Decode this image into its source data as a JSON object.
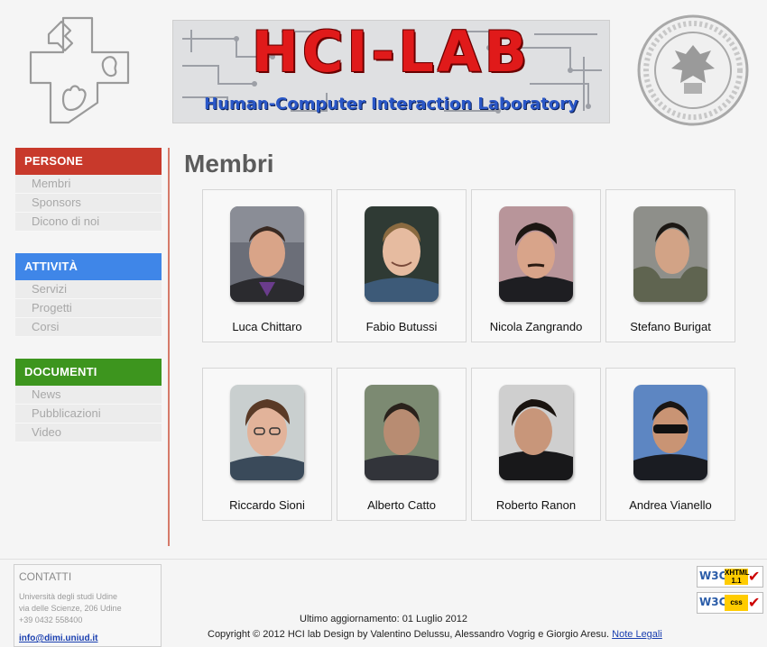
{
  "header": {
    "banner_title": "HCI-LAB",
    "banner_subtitle": "Human-Computer Interaction Laboratory"
  },
  "sidebar": {
    "sections": [
      {
        "label": "PERSONE",
        "color": "#c8392b",
        "items": [
          "Membri",
          "Sponsors",
          "Dicono di noi"
        ]
      },
      {
        "label": "ATTIVITÀ",
        "color": "#3f86e8",
        "items": [
          "Servizi",
          "Progetti",
          "Corsi"
        ]
      },
      {
        "label": "DOCUMENTI",
        "color": "#3d951e",
        "items": [
          "News",
          "Pubblicazioni",
          "Video"
        ]
      }
    ]
  },
  "main": {
    "title": "Membri",
    "members": [
      {
        "name": "Luca Chittaro",
        "icon": "portrait-photo"
      },
      {
        "name": "Fabio Butussi",
        "icon": "portrait-photo"
      },
      {
        "name": "Nicola Zangrando",
        "icon": "portrait-photo"
      },
      {
        "name": "Stefano Burigat",
        "icon": "portrait-photo"
      },
      {
        "name": "Riccardo Sioni",
        "icon": "portrait-photo"
      },
      {
        "name": "Alberto Catto",
        "icon": "portrait-photo"
      },
      {
        "name": "Roberto Ranon",
        "icon": "portrait-photo"
      },
      {
        "name": "Andrea Vianello",
        "icon": "portrait-photo"
      }
    ]
  },
  "footer": {
    "contact_title": "CONTATTI",
    "contact_lines": [
      "Università degli studi Udine",
      "via delle Scienze, 206 Udine",
      "+39 0432 558400"
    ],
    "contact_email": "info@dimi.uniud.it",
    "updated": "Ultimo aggiornamento: 01 Luglio 2012",
    "copyright": "Copyright © 2012 HCI lab Design by Valentino Delussu, Alessandro Vogrig e Giorgio Aresu.",
    "legal_link": "Note Legali",
    "badges": [
      {
        "logo": "W3C",
        "tag_line1": "XHTML",
        "tag_line2": "1.1"
      },
      {
        "logo": "W3C",
        "tag_line1": "css",
        "tag_line2": ""
      }
    ]
  },
  "colors": {
    "persone": "#c8392b",
    "attivita": "#3f86e8",
    "documenti": "#3d951e",
    "divider": "#d67a6a"
  }
}
